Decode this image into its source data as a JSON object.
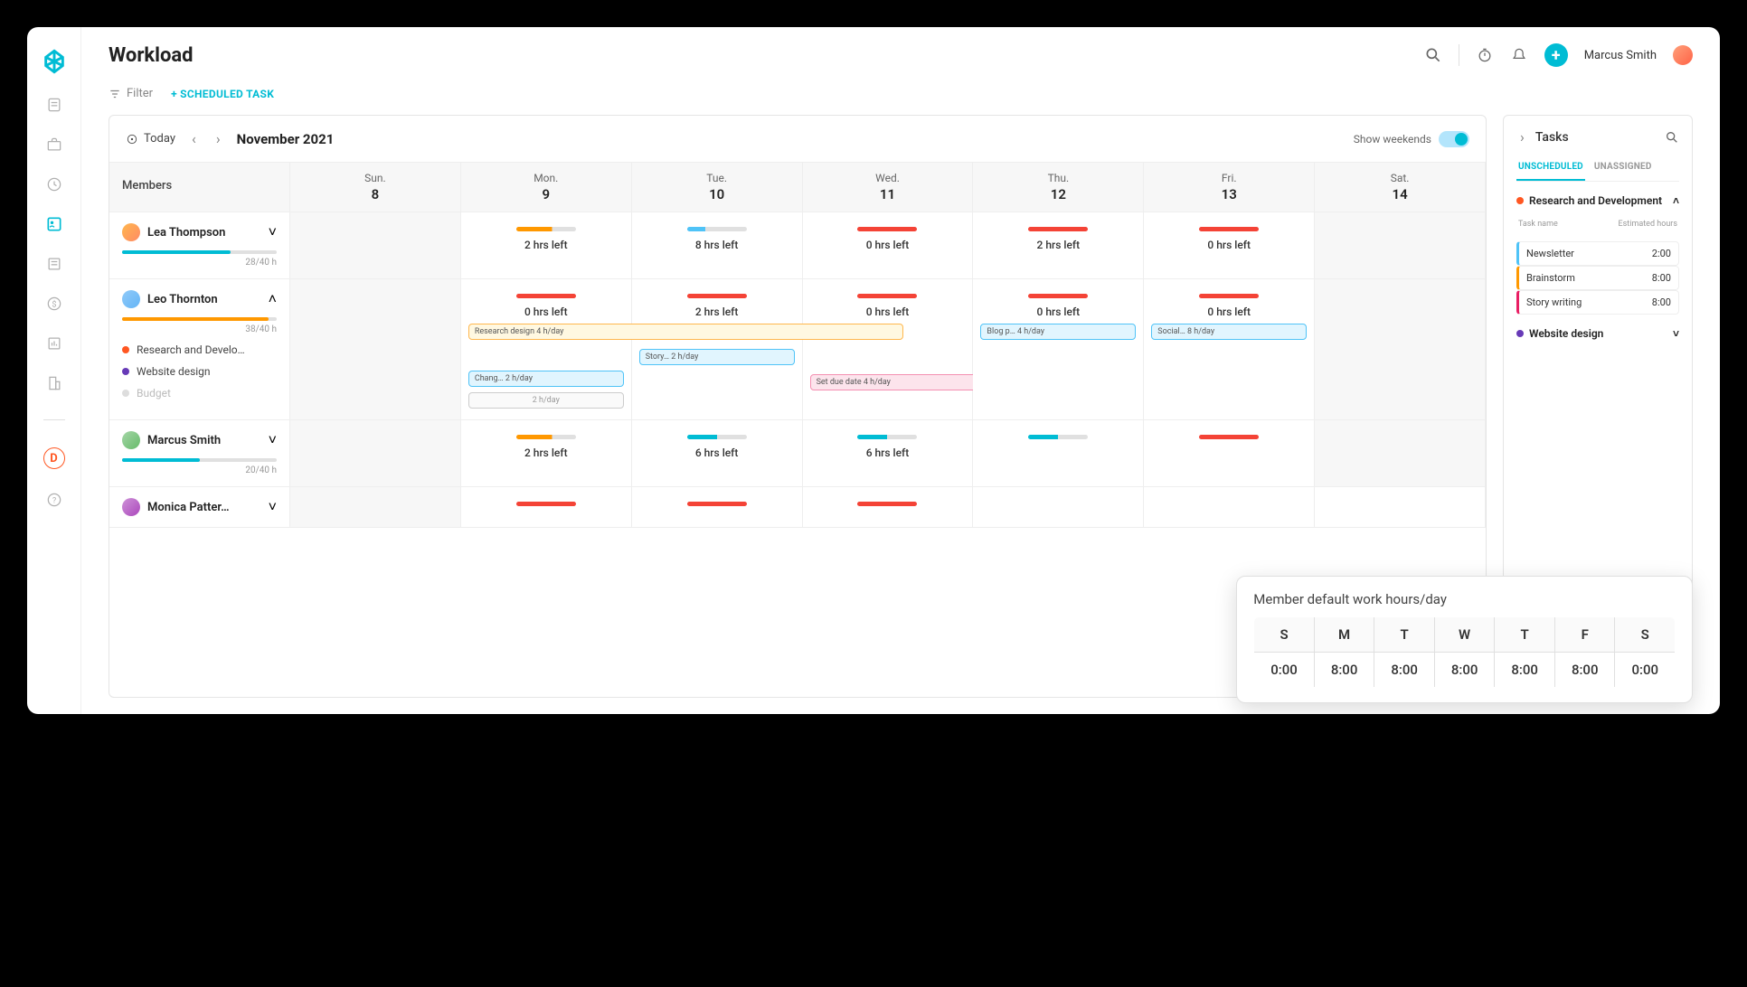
{
  "page_title": "Workload",
  "user": {
    "name": "Marcus Smith"
  },
  "toolbar": {
    "filter": "Filter",
    "scheduled_task": "+ SCHEDULED TASK"
  },
  "calendar": {
    "today": "Today",
    "month": "November 2021",
    "show_weekends": "Show weekends",
    "members_label": "Members",
    "days": [
      {
        "dow": "Sun.",
        "num": "8",
        "weekend": true
      },
      {
        "dow": "Mon.",
        "num": "9"
      },
      {
        "dow": "Tue.",
        "num": "10"
      },
      {
        "dow": "Wed.",
        "num": "11"
      },
      {
        "dow": "Thu.",
        "num": "12"
      },
      {
        "dow": "Fri.",
        "num": "13"
      },
      {
        "dow": "Sat.",
        "num": "14",
        "weekend": true
      }
    ]
  },
  "members": [
    {
      "name": "Lea Thompson",
      "hours": "28/40 h",
      "bar_pct": 70,
      "bar_color": "#00bcd4",
      "expanded": false,
      "days": [
        {
          "weekend": true
        },
        {
          "bar": "orange",
          "label": "2 hrs left"
        },
        {
          "bar": "blue",
          "label": "8 hrs left"
        },
        {
          "bar": "red",
          "label": "0 hrs left"
        },
        {
          "bar": "red",
          "label": "2 hrs left"
        },
        {
          "bar": "red",
          "label": "0 hrs left"
        },
        {
          "weekend": true
        }
      ]
    },
    {
      "name": "Leo Thornton",
      "hours": "38/40 h",
      "bar_pct": 95,
      "bar_color": "#ff9800",
      "expanded": true,
      "projects": [
        {
          "name": "Research and Develo…",
          "color": "#ff5722"
        },
        {
          "name": "Website design",
          "color": "#673ab7"
        },
        {
          "name": "Budget",
          "color": "#ddd",
          "muted": true
        }
      ],
      "days": [
        {
          "weekend": true
        },
        {
          "bar": "red",
          "label": "0 hrs left"
        },
        {
          "bar": "red",
          "label": "2 hrs left"
        },
        {
          "bar": "red",
          "label": "0 hrs left"
        },
        {
          "bar": "red",
          "label": "0 hrs left"
        },
        {
          "bar": "red",
          "label": "0 hrs left"
        },
        {
          "weekend": true
        }
      ],
      "tasks_row1_mon": "Research design   4 h/day",
      "tasks_row1_thu": "Blog p…  4 h/day",
      "tasks_row1_fri": "Social…  8 h/day",
      "tasks_row2_tue": "Story…  2 h/day",
      "tasks_row3_mon": "Chang…  2 h/day",
      "tasks_row3_wed": "Set due date   4 h/day",
      "tasks_row4_mon": "2 h/day"
    },
    {
      "name": "Marcus Smith",
      "hours": "20/40 h",
      "bar_pct": 50,
      "bar_color": "#00bcd4",
      "expanded": false,
      "days": [
        {
          "weekend": true
        },
        {
          "bar": "orange",
          "label": "2 hrs left"
        },
        {
          "bar": "teal",
          "label": "6 hrs left"
        },
        {
          "bar": "teal",
          "label": "6 hrs left"
        },
        {
          "bar": "teal",
          "label": ""
        },
        {
          "bar": "red",
          "label": ""
        },
        {
          "weekend": true
        }
      ]
    },
    {
      "name": "Monica Patter…",
      "hours": "",
      "expanded": false,
      "days": [
        {
          "weekend": true
        },
        {
          "bar": "red",
          "label": ""
        },
        {
          "bar": "red",
          "label": ""
        },
        {
          "bar": "red",
          "label": ""
        },
        {},
        {},
        {}
      ]
    }
  ],
  "tasks_panel": {
    "title": "Tasks",
    "tabs": {
      "unscheduled": "UNSCHEDULED",
      "unassigned": "UNASSIGNED"
    },
    "project1": {
      "name": "Research and Development",
      "color": "#ff5722",
      "head_name": "Task name",
      "head_est": "Estimated hours",
      "items": [
        {
          "name": "Newsletter",
          "hours": "2:00",
          "color": "blue"
        },
        {
          "name": "Brainstorm",
          "hours": "8:00",
          "color": "orange"
        },
        {
          "name": "Story writing",
          "hours": "8:00",
          "color": "pink"
        }
      ]
    },
    "project2": {
      "name": "Website design",
      "color": "#673ab7"
    }
  },
  "workhours": {
    "title": "Member default work hours/day",
    "days": [
      "S",
      "M",
      "T",
      "W",
      "T",
      "F",
      "S"
    ],
    "values": [
      "0:00",
      "8:00",
      "8:00",
      "8:00",
      "8:00",
      "8:00",
      "0:00"
    ]
  }
}
